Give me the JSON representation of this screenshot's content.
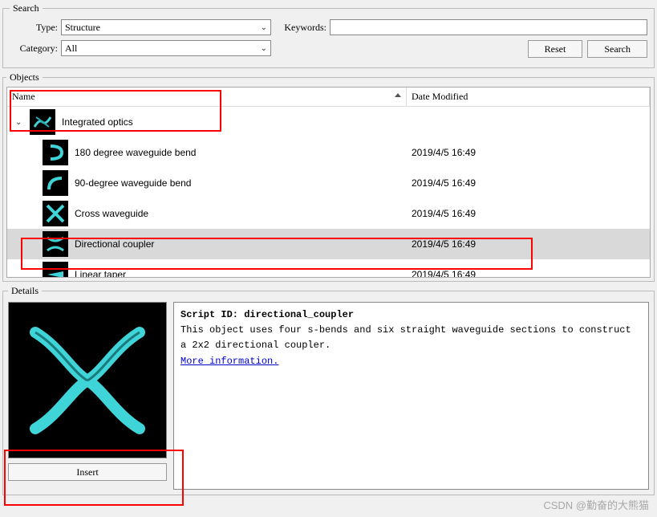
{
  "search": {
    "legend": "Search",
    "type_label": "Type:",
    "type_value": "Structure",
    "keywords_label": "Keywords:",
    "keywords_value": "",
    "category_label": "Category:",
    "category_value": "All",
    "reset_label": "Reset",
    "search_label": "Search"
  },
  "objects": {
    "legend": "Objects",
    "columns": {
      "name": "Name",
      "date": "Date Modified"
    },
    "parent": {
      "name": "Integrated optics",
      "date": ""
    },
    "items": [
      {
        "name": "180 degree waveguide bend",
        "date": "2019/4/5 16:49"
      },
      {
        "name": "90-degree waveguide bend",
        "date": "2019/4/5 16:49"
      },
      {
        "name": "Cross waveguide",
        "date": "2019/4/5 16:49"
      },
      {
        "name": "Directional coupler",
        "date": "2019/4/5 16:49",
        "selected": true
      },
      {
        "name": "Linear taper",
        "date": "2019/4/5 16:49"
      }
    ]
  },
  "details": {
    "legend": "Details",
    "script_id_label": "Script ID:",
    "script_id": "directional_coupler",
    "description": "This object uses four s-bends and six straight waveguide sections to construct a 2x2 directional coupler.",
    "more_info": "More information.",
    "insert_label": "Insert"
  },
  "watermark": "CSDN @勤奋的大熊猫"
}
